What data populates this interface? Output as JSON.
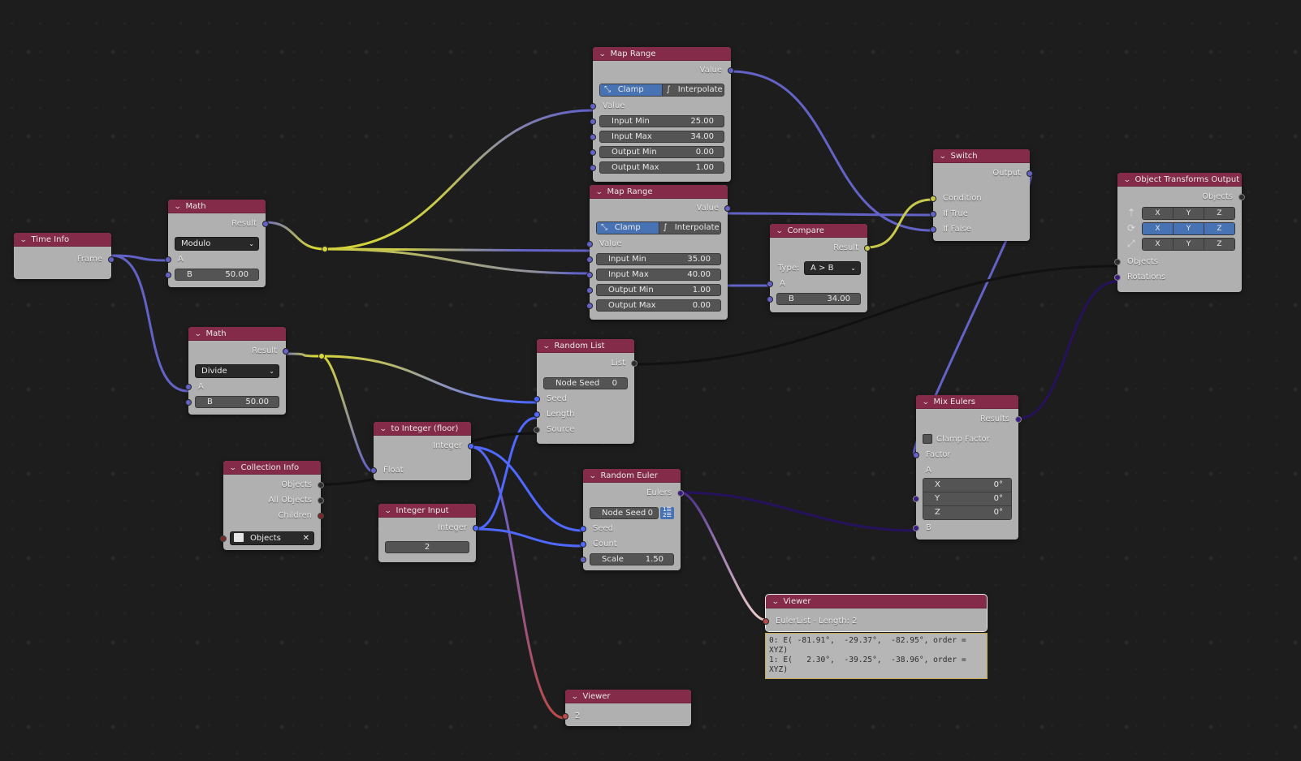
{
  "editor": "Geometry Node Editor",
  "colors": {
    "background": "#1d1d1d",
    "node_header": "#832b48",
    "node_body": "#b0b0b0",
    "active_toggle": "#4772b3",
    "float_socket": "#6363c7",
    "int_socket": "#4f68ff",
    "bool_socket": "#c8c84e",
    "euler_socket": "#3b1d82",
    "collection_socket": "#7a2626"
  },
  "nodes": {
    "time_info": {
      "title": "Time Info",
      "outputs": [
        "Frame"
      ]
    },
    "math_modulo": {
      "title": "Math",
      "output": "Result",
      "operation": "Modulo",
      "input_a": "A",
      "input_b_label": "B",
      "input_b_value": "50.00"
    },
    "math_divide": {
      "title": "Math",
      "output": "Result",
      "operation": "Divide",
      "input_a": "A",
      "input_b_label": "B",
      "input_b_value": "50.00"
    },
    "map_range_1": {
      "title": "Map Range",
      "output": "Value",
      "clamp_label": "Clamp",
      "interpolate_label": "Interpolate",
      "clamp_active": true,
      "value_input": "Value",
      "fields": [
        {
          "label": "Input Min",
          "value": "25.00"
        },
        {
          "label": "Input Max",
          "value": "34.00"
        },
        {
          "label": "Output Min",
          "value": "0.00"
        },
        {
          "label": "Output Max",
          "value": "1.00"
        }
      ]
    },
    "map_range_2": {
      "title": "Map Range",
      "output": "Value",
      "clamp_label": "Clamp",
      "interpolate_label": "Interpolate",
      "clamp_active": true,
      "value_input": "Value",
      "fields": [
        {
          "label": "Input Min",
          "value": "35.00"
        },
        {
          "label": "Input Max",
          "value": "40.00"
        },
        {
          "label": "Output Min",
          "value": "1.00"
        },
        {
          "label": "Output Max",
          "value": "0.00"
        }
      ]
    },
    "compare": {
      "title": "Compare",
      "output": "Result",
      "type_label": "Type:",
      "type_value": "A > B",
      "input_a": "A",
      "input_b_label": "B",
      "input_b_value": "34.00"
    },
    "switch": {
      "title": "Switch",
      "output": "Output",
      "inputs": [
        "Condition",
        "If True",
        "If False"
      ]
    },
    "object_transforms_output": {
      "title": "Object Transforms Output",
      "output": "Objects",
      "axis_labels": [
        "X",
        "Y",
        "Z"
      ],
      "rows": [
        {
          "icon": "location-icon",
          "glyph": "⇡",
          "active": false
        },
        {
          "icon": "rotation-icon",
          "glyph": "⟳",
          "active": true
        },
        {
          "icon": "scale-icon",
          "glyph": "⤢",
          "active": false
        }
      ],
      "inputs": [
        "Objects",
        "Rotations"
      ]
    },
    "random_list": {
      "title": "Random List",
      "output": "List",
      "seed_label": "Node Seed",
      "seed_value": "0",
      "inputs": [
        "Seed",
        "Length",
        "Source"
      ]
    },
    "to_integer": {
      "title": "to Integer (floor)",
      "output": "Integer",
      "input": "Float"
    },
    "collection_info": {
      "title": "Collection Info",
      "outputs": [
        "Objects",
        "All Objects",
        "Children"
      ],
      "collection_value": "Objects"
    },
    "integer_input": {
      "title": "Integer Input",
      "output": "Integer",
      "value": "2"
    },
    "random_euler": {
      "title": "Random Euler",
      "output": "Eulers",
      "seed_label": "Node Seed",
      "seed_value": "0",
      "inputs": [
        "Seed",
        "Count"
      ],
      "scale_label": "Scale",
      "scale_value": "1.50"
    },
    "mix_eulers": {
      "title": "Mix Eulers",
      "output": "Results",
      "clamp_label": "Clamp Factor",
      "clamp_checked": false,
      "factor_label": "Factor",
      "a_label": "A",
      "a_values": [
        {
          "label": "X",
          "value": "0°"
        },
        {
          "label": "Y",
          "value": "0°"
        },
        {
          "label": "Z",
          "value": "0°"
        }
      ],
      "b_label": "B"
    },
    "viewer_euler": {
      "title": "Viewer",
      "input": "EulerList - Length: 2",
      "text": "0: E( -81.91°,  -29.37°,  -82.95°, order =\nXYZ)\n1: E(   2.30°,  -39.25°,  -38.96°, order =\nXYZ)"
    },
    "viewer_int": {
      "title": "Viewer",
      "input": "2"
    }
  }
}
